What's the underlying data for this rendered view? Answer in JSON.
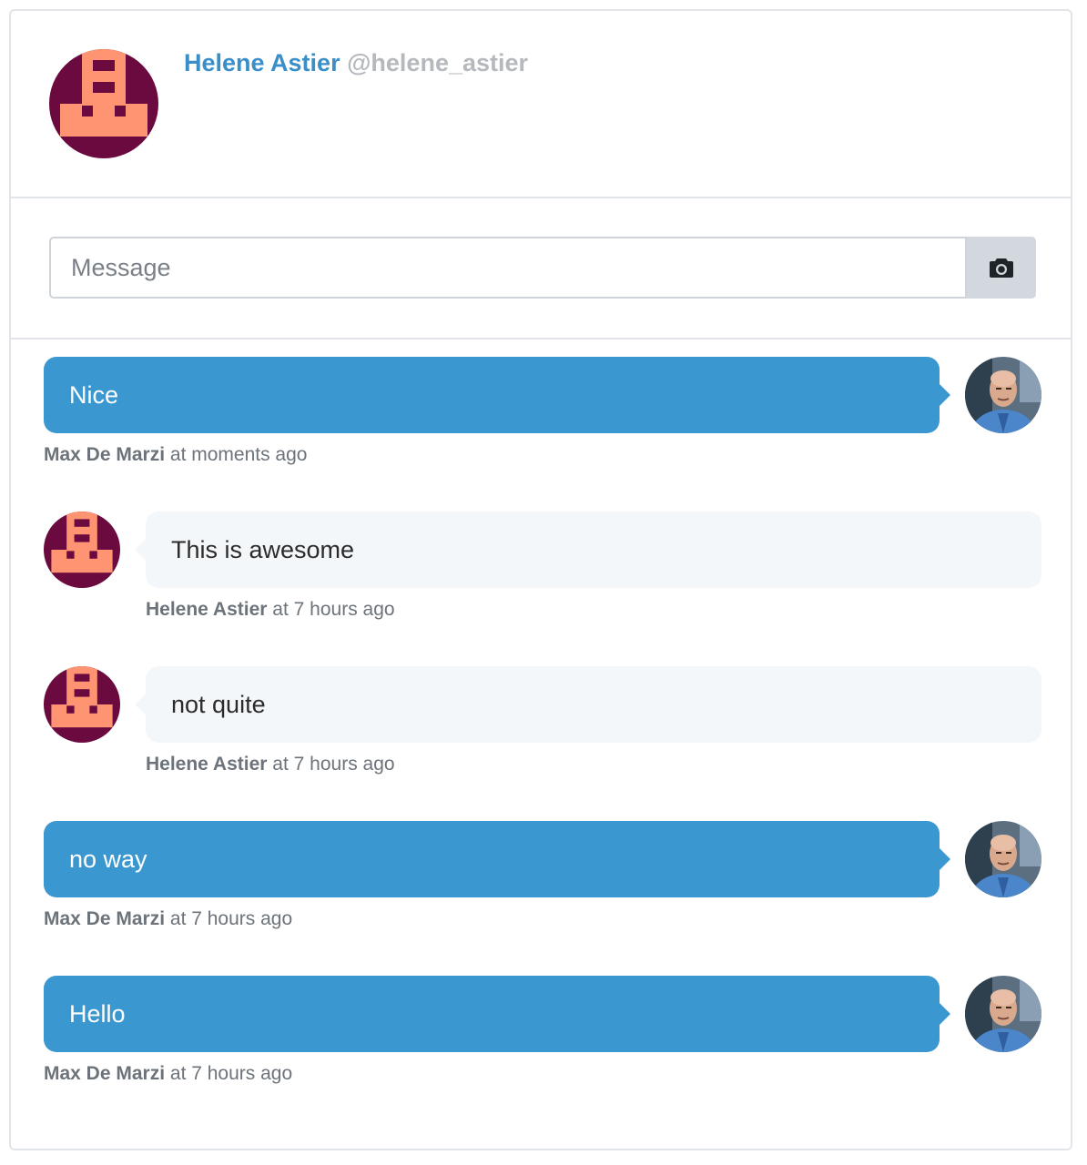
{
  "profile": {
    "name": "Helene Astier",
    "handle": "@helene_astier"
  },
  "composer": {
    "placeholder": "Message",
    "value": "",
    "attach_icon": "camera-icon"
  },
  "colors": {
    "accent": "#3a97d0",
    "name_link": "#3a8fc9",
    "identicon_bg": "#6b0a3f",
    "identicon_fg": "#ff9473",
    "incoming_bubble": "#f4f7fa"
  },
  "messages": [
    {
      "direction": "outgoing",
      "text": "Nice",
      "author": "Max De Marzi",
      "time": "at moments ago",
      "avatar": "user-photo"
    },
    {
      "direction": "incoming",
      "text": "This is awesome",
      "author": "Helene Astier",
      "time": "at 7 hours ago",
      "avatar": "identicon"
    },
    {
      "direction": "incoming",
      "text": "not quite",
      "author": "Helene Astier",
      "time": "at 7 hours ago",
      "avatar": "identicon"
    },
    {
      "direction": "outgoing",
      "text": "no way",
      "author": "Max De Marzi",
      "time": "at 7 hours ago",
      "avatar": "user-photo"
    },
    {
      "direction": "outgoing",
      "text": "Hello",
      "author": "Max De Marzi",
      "time": "at 7 hours ago",
      "avatar": "user-photo"
    }
  ]
}
